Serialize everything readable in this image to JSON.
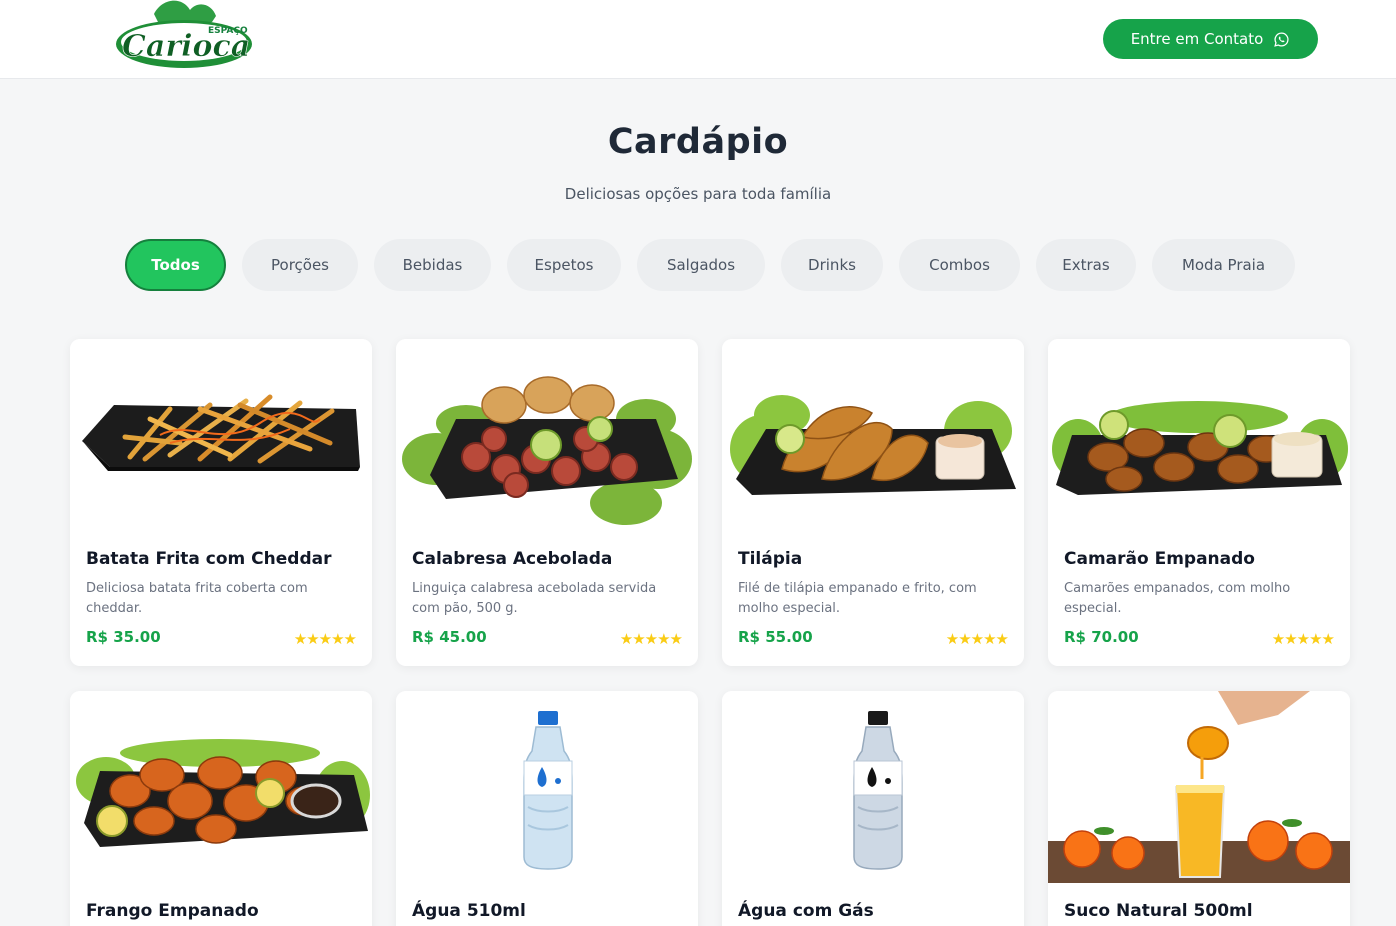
{
  "header": {
    "logo_small": "ESPAÇO",
    "logo_main": "Carioca",
    "contact_label": "Entre em Contato",
    "contact_icon": "whatsapp-icon"
  },
  "menu": {
    "title": "Cardápio",
    "subtitle": "Deliciosas opções para toda família"
  },
  "tabs": [
    "Todos",
    "Porções",
    "Bebidas",
    "Espetos",
    "Salgados",
    "Drinks",
    "Combos",
    "Extras",
    "Moda Praia"
  ],
  "active_tab": "Todos",
  "colors": {
    "brand": "#16a34a",
    "active_tab": "#22c55e",
    "stars": "#facc15"
  },
  "products": [
    {
      "name": "Batata Frita com Cheddar",
      "description": "Deliciosa batata frita coberta com cheddar.",
      "price": "R$ 35.00",
      "rating": 5
    },
    {
      "name": "Calabresa Acebolada",
      "description": "Linguiça calabresa acebolada servida com pão, 500 g.",
      "price": "R$ 45.00",
      "rating": 5
    },
    {
      "name": "Tilápia",
      "description": "Filé de tilápia empanado e frito, com molho especial.",
      "price": "R$ 55.00",
      "rating": 5
    },
    {
      "name": "Camarão Empanado",
      "description": "Camarões empanados, com molho especial.",
      "price": "R$ 70.00",
      "rating": 5
    },
    {
      "name": "Frango Empanado"
    },
    {
      "name": "Água 510ml"
    },
    {
      "name": "Água com Gás"
    },
    {
      "name": "Suco Natural 500ml"
    }
  ]
}
